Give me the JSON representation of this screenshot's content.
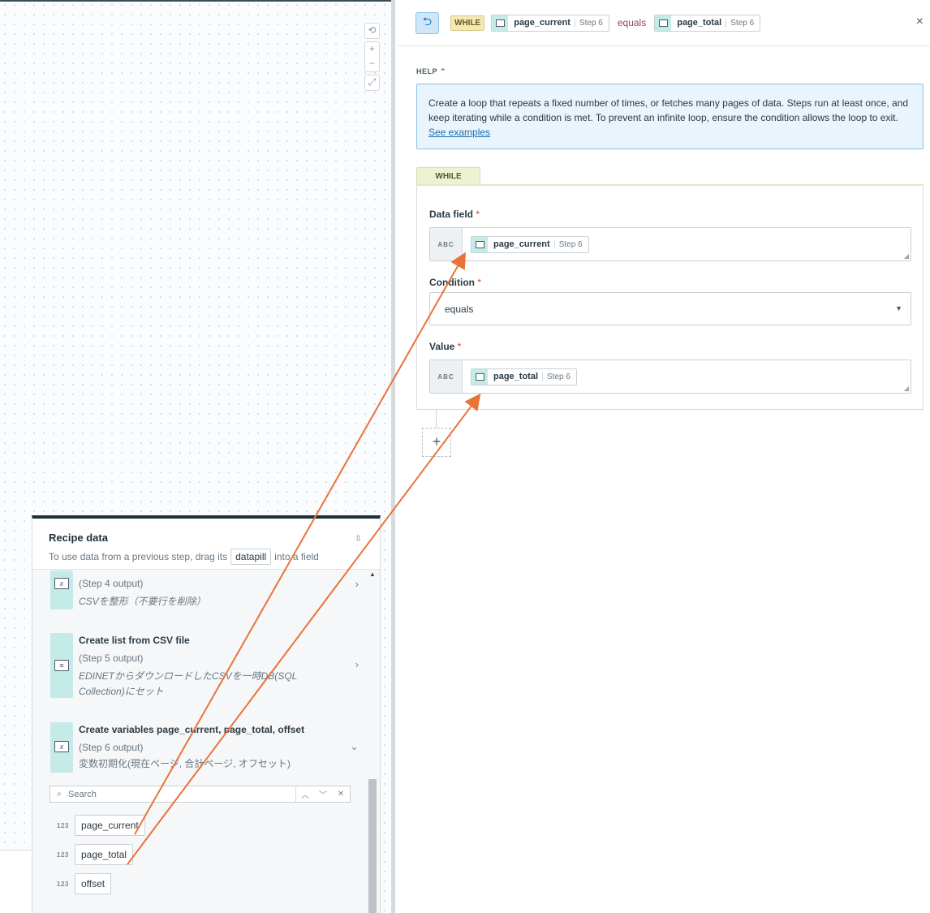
{
  "canvas": {
    "zoom_controls": [
      "⟲",
      "+",
      "−",
      "⤢"
    ]
  },
  "header": {
    "keyword": "WHILE",
    "left_pill": {
      "name": "page_current",
      "step": "Step 6"
    },
    "operator": "equals",
    "right_pill": {
      "name": "page_total",
      "step": "Step 6"
    },
    "close": "×"
  },
  "help": {
    "label": "HELP",
    "text": "Create a loop that repeats a fixed number of times, or fetches many pages of data. Steps run at least once, and keep iterating while a condition is met. To prevent an infinite loop, ensure the condition allows the loop to exit.",
    "link": "See examples"
  },
  "form": {
    "tab": "WHILE",
    "data_field": {
      "label": "Data field",
      "type": "ABC",
      "pill_name": "page_current",
      "pill_step": "Step 6"
    },
    "condition": {
      "label": "Condition",
      "value": "equals"
    },
    "value": {
      "label": "Value",
      "type": "ABC",
      "pill_name": "page_total",
      "pill_step": "Step 6"
    },
    "required_mark": "*",
    "add_step": "+"
  },
  "recipe_data": {
    "title": "Recipe data",
    "sub_before": "To use data from a previous step, drag its",
    "sub_pill": "datapill",
    "sub_after": "into a field",
    "steps": [
      {
        "title": "",
        "output": "(Step 4 output)",
        "desc": "CSVを整形（不要行を削除）"
      },
      {
        "title": "Create list from CSV file",
        "output": "(Step 5 output)",
        "desc": "EDINETからダウンロードしたCSVを一時DB(SQL Collection)にセット"
      },
      {
        "title": "Create variables page_current, page_total, offset",
        "output": "(Step 6 output)",
        "desc": "変数初期化(現在ページ, 合計ページ, オフセット)"
      }
    ],
    "search_placeholder": "Search",
    "datapills": [
      {
        "type": "123",
        "name": "page_current"
      },
      {
        "type": "123",
        "name": "page_total"
      },
      {
        "type": "123",
        "name": "offset"
      }
    ]
  }
}
